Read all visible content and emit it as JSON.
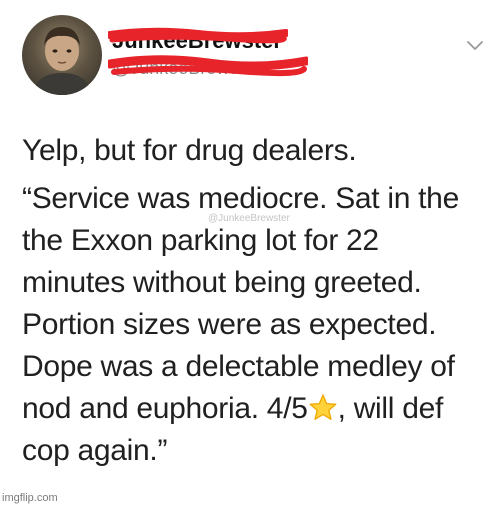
{
  "user": {
    "display_name": "JunkeeBrewster",
    "handle": "@JunkeeBrewster",
    "redaction_color": "#e8242b"
  },
  "icons": {
    "menu": "chevron-down-icon",
    "rating": "star-icon"
  },
  "tweet": {
    "intro": "Yelp, but for drug dealers.",
    "lines": [
      "“Service was mediocre. Sat in the",
      "the Exxon parking lot for 22",
      "minutes without being greeted.",
      "Portion sizes were as expected.",
      "Dope was a delectable medley of"
    ],
    "rating_line_before": "nod and euphoria. 4/5",
    "rating_line_after": ", will def",
    "last_line": "cop again.”"
  },
  "watermarks": {
    "inline": "@JunkeeBrewster",
    "footer": "imgflip.com"
  }
}
